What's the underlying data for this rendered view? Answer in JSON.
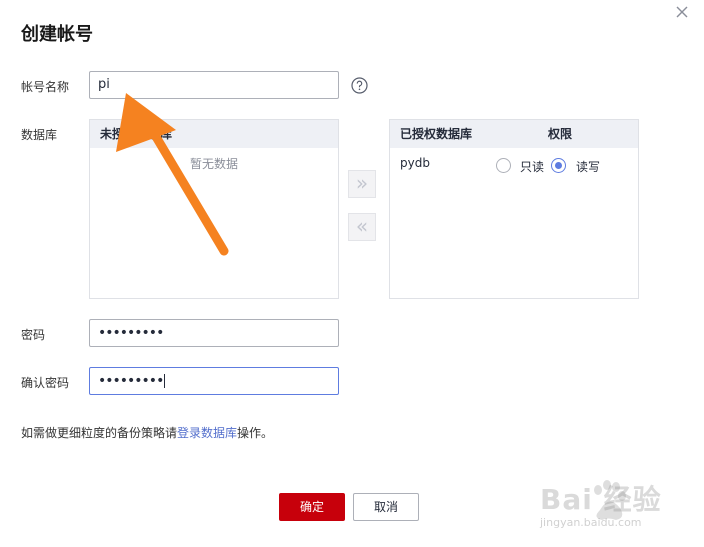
{
  "dialog": {
    "title": "创建帐号"
  },
  "form": {
    "account_name_label": "帐号名称",
    "account_name_value": "pi",
    "database_label": "数据库",
    "password_label": "密码",
    "password_value": "•••••••••",
    "confirm_password_label": "确认密码",
    "confirm_password_value": "•••••••••"
  },
  "left_panel": {
    "header": "未授权数据库",
    "empty_text": "暂无数据"
  },
  "right_panel": {
    "header": "已授权数据库",
    "perm_header": "权限",
    "rows": [
      {
        "name": "pydb",
        "readonly_label": "只读",
        "readwrite_label": "读写",
        "selected": "readwrite"
      }
    ]
  },
  "transfer": {
    "add_glyph": "»",
    "remove_glyph": "«"
  },
  "hint": {
    "prefix": "如需做更细粒度的备份策略请",
    "link": "登录数据库",
    "suffix": "操作。"
  },
  "buttons": {
    "confirm": "确定",
    "cancel": "取消"
  },
  "colors": {
    "primary": "#c7000b",
    "accent": "#5e7ce0",
    "arrow": "#f58220"
  },
  "watermark": {
    "text": "Bai 经验",
    "sub": "jingyan.baidu.com"
  }
}
